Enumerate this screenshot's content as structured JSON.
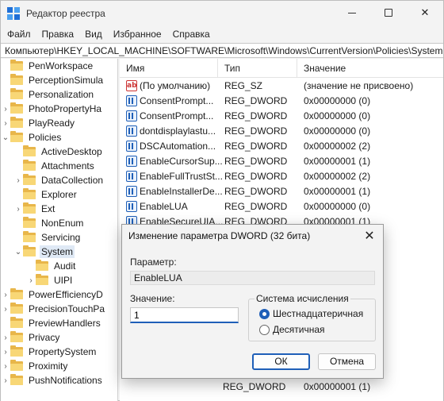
{
  "window": {
    "title": "Редактор реестра"
  },
  "menu": [
    "Файл",
    "Правка",
    "Вид",
    "Избранное",
    "Справка"
  ],
  "address": "Компьютер\\HKEY_LOCAL_MACHINE\\SOFTWARE\\Microsoft\\Windows\\CurrentVersion\\Policies\\System",
  "tree": [
    {
      "label": "PenWorkspace",
      "level": 1,
      "chevron": ""
    },
    {
      "label": "PerceptionSimula",
      "level": 1,
      "chevron": ""
    },
    {
      "label": "Personalization",
      "level": 1,
      "chevron": ""
    },
    {
      "label": "PhotoPropertyHa",
      "level": 1,
      "chevron": "›"
    },
    {
      "label": "PlayReady",
      "level": 1,
      "chevron": "›"
    },
    {
      "label": "Policies",
      "level": 1,
      "chevron": "⌄"
    },
    {
      "label": "ActiveDesktop",
      "level": 2,
      "chevron": ""
    },
    {
      "label": "Attachments",
      "level": 2,
      "chevron": ""
    },
    {
      "label": "DataCollection",
      "level": 2,
      "chevron": "›"
    },
    {
      "label": "Explorer",
      "level": 2,
      "chevron": ""
    },
    {
      "label": "Ext",
      "level": 2,
      "chevron": "›"
    },
    {
      "label": "NonEnum",
      "level": 2,
      "chevron": ""
    },
    {
      "label": "Servicing",
      "level": 2,
      "chevron": ""
    },
    {
      "label": "System",
      "level": 2,
      "chevron": "⌄",
      "selected": true
    },
    {
      "label": "Audit",
      "level": 3,
      "chevron": ""
    },
    {
      "label": "UIPI",
      "level": 3,
      "chevron": "›"
    },
    {
      "label": "PowerEfficiencyD",
      "level": 1,
      "chevron": "›"
    },
    {
      "label": "PrecisionTouchPa",
      "level": 1,
      "chevron": "›"
    },
    {
      "label": "PreviewHandlers",
      "level": 1,
      "chevron": ""
    },
    {
      "label": "Privacy",
      "level": 1,
      "chevron": "›"
    },
    {
      "label": "PropertySystem",
      "level": 1,
      "chevron": "›"
    },
    {
      "label": "Proximity",
      "level": 1,
      "chevron": "›"
    },
    {
      "label": "PushNotifications",
      "level": 1,
      "chevron": "›"
    }
  ],
  "columns": {
    "name": "Имя",
    "type": "Тип",
    "value": "Значение"
  },
  "values": [
    {
      "icon": "ab",
      "name": "(По умолчанию)",
      "type": "REG_SZ",
      "value": "(значение не присвоено)"
    },
    {
      "icon": "bin",
      "name": "ConsentPrompt...",
      "type": "REG_DWORD",
      "value": "0x00000000 (0)"
    },
    {
      "icon": "bin",
      "name": "ConsentPrompt...",
      "type": "REG_DWORD",
      "value": "0x00000000 (0)"
    },
    {
      "icon": "bin",
      "name": "dontdisplaylastu...",
      "type": "REG_DWORD",
      "value": "0x00000000 (0)"
    },
    {
      "icon": "bin",
      "name": "DSCAutomation...",
      "type": "REG_DWORD",
      "value": "0x00000002 (2)"
    },
    {
      "icon": "bin",
      "name": "EnableCursorSup...",
      "type": "REG_DWORD",
      "value": "0x00000001 (1)"
    },
    {
      "icon": "bin",
      "name": "EnableFullTrustSt...",
      "type": "REG_DWORD",
      "value": "0x00000002 (2)"
    },
    {
      "icon": "bin",
      "name": "EnableInstallerDe...",
      "type": "REG_DWORD",
      "value": "0x00000001 (1)"
    },
    {
      "icon": "bin",
      "name": "EnableLUA",
      "type": "REG_DWORD",
      "value": "0x00000000 (0)"
    },
    {
      "icon": "bin",
      "name": "EnableSecureUIA...",
      "type": "REG_DWORD",
      "value": "0x00000001 (1)"
    }
  ],
  "bottom_row": {
    "type": "REG_DWORD",
    "value": "0x00000001 (1)"
  },
  "dialog": {
    "title": "Изменение параметра DWORD (32 бита)",
    "param_label": "Параметр:",
    "param_value": "EnableLUA",
    "value_label": "Значение:",
    "value": "1",
    "radix_label": "Система исчисления",
    "radix_hex": "Шестнадцатеричная",
    "radix_dec": "Десятичная",
    "ok": "ОК",
    "cancel": "Отмена"
  }
}
